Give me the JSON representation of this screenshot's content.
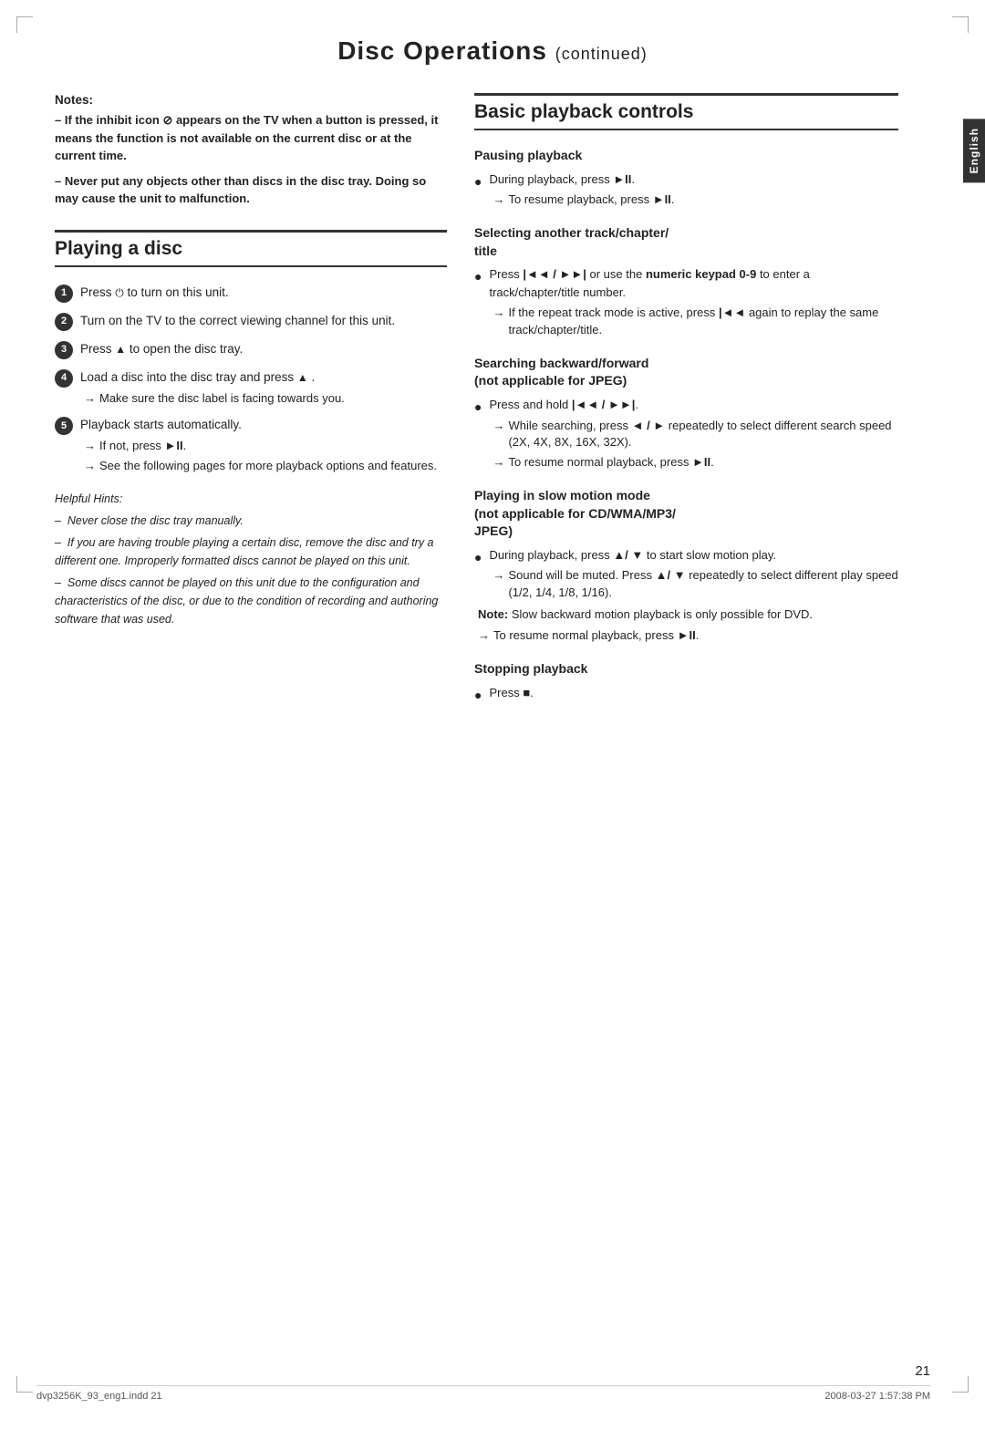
{
  "page": {
    "title": "Disc Operations",
    "title_continued": "(continued)",
    "page_number": "21",
    "footer_left": "dvp3256K_93_eng1.indd  21",
    "footer_right": "2008-03-27  1:57:38 PM",
    "english_tab": "English"
  },
  "notes": {
    "title": "Notes:",
    "line1": "–  If the inhibit icon ⊘ appears on the TV when a button is pressed, it means the function is not available on the current disc or at the current time.",
    "line2": "–  Never put any objects other than discs in the disc tray. Doing so may cause the unit to malfunction."
  },
  "playing_a_disc": {
    "section_title": "Playing a disc",
    "steps": [
      {
        "num": "1",
        "text": "Press ⏻ to turn on this unit."
      },
      {
        "num": "2",
        "text": "Turn on the TV to the correct viewing channel for this unit."
      },
      {
        "num": "3",
        "text": "Press ▲ to open the disc tray."
      },
      {
        "num": "4",
        "text": "Load a disc into the disc tray and press ▲.",
        "arrow": "→ Make sure the disc label is facing towards you."
      },
      {
        "num": "5",
        "text": "Playback starts automatically.",
        "arrows": [
          "→ If not, press ►II.",
          "→ See the following pages for more playback options and features."
        ]
      }
    ],
    "helpful_hints": {
      "title": "Helpful Hints:",
      "lines": [
        "–  Never close the disc tray manually.",
        "–  If you are having trouble playing a certain disc, remove the disc and try a different one. Improperly formatted discs cannot be played on this unit.",
        "–  Some discs cannot be played on this unit due to the configuration and characteristics of the disc, or due to the condition of recording and authoring software that was used."
      ]
    }
  },
  "basic_playback": {
    "section_title": "Basic playback controls",
    "subsections": [
      {
        "id": "pausing",
        "title": "Pausing playback",
        "bullets": [
          {
            "text": "During playback, press ►II.",
            "arrow": "→ To resume playback, press ►II."
          }
        ]
      },
      {
        "id": "selecting",
        "title": "Selecting another track/chapter/title",
        "bullets": [
          {
            "text": "Press |◄◄ / ►►| or use the numeric keypad 0-9 to enter a track/chapter/title number.",
            "arrows": [
              "→ If the repeat track mode is active, press |◄◄ again to replay the same track/chapter/title."
            ]
          }
        ]
      },
      {
        "id": "searching",
        "title": "Searching backward/forward (not applicable for JPEG)",
        "bullets": [
          {
            "text": "Press and hold |◄◄ / ►►|.",
            "arrows": [
              "→ While searching, press ◄ / ► repeatedly to select different search speed (2X, 4X, 8X, 16X, 32X).",
              "→ To resume normal playback, press ►II."
            ]
          }
        ]
      },
      {
        "id": "slow_motion",
        "title": "Playing in slow motion mode (not applicable for CD/WMA/MP3/JPEG)",
        "bullets": [
          {
            "text": "During playback, press ▲/ ▼ to start slow motion play.",
            "arrows": [
              "→ Sound will be muted. Press ▲/ ▼ repeatedly to select different play speed (1/2, 1/4, 1/8, 1/16)."
            ]
          }
        ],
        "note": "Note: Slow backward motion playback is only possible for DVD.",
        "extra_arrow": "→ To resume normal playback, press ►II."
      },
      {
        "id": "stopping",
        "title": "Stopping playback",
        "bullets": [
          {
            "text": "Press ■."
          }
        ]
      }
    ]
  }
}
